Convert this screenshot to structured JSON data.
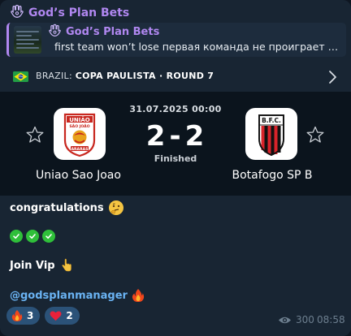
{
  "channel": {
    "name": "God’s Plan Bets"
  },
  "reply": {
    "title": "God’s Plan Bets",
    "text": "first team won’t lose первая команда не проиграет  @godsplanmanager"
  },
  "league": {
    "country": "BRAZIL:",
    "competition": "COPA PAULISTA · ROUND 7",
    "flag_icon": "brazil-flag-icon"
  },
  "match": {
    "date": "31.07.2025 00:00",
    "home": {
      "name": "Uniao Sao Joao",
      "logo_text_top": "UNIÃO",
      "logo_text_mid": "SÃO JOÃO",
      "logo_text_bottom": "ARARAS"
    },
    "away": {
      "name": "Botafogo SP B",
      "logo_text": "B.F.C."
    },
    "home_score": "2",
    "away_score": "2",
    "separator": "-",
    "status": "Finished"
  },
  "message": {
    "congrats": "congratulations",
    "join": "Join Vip",
    "handle": "@godsplanmanager"
  },
  "reactions": [
    {
      "icon": "fire-icon",
      "count": "3"
    },
    {
      "icon": "heart-icon",
      "count": "2"
    }
  ],
  "meta": {
    "views": "300",
    "time": "08:58"
  },
  "colors": {
    "accent_purple": "#b087f0",
    "link_blue": "#6ab3f3",
    "reaction_bg": "#2b5278",
    "check_green": "#2fbf3a"
  }
}
